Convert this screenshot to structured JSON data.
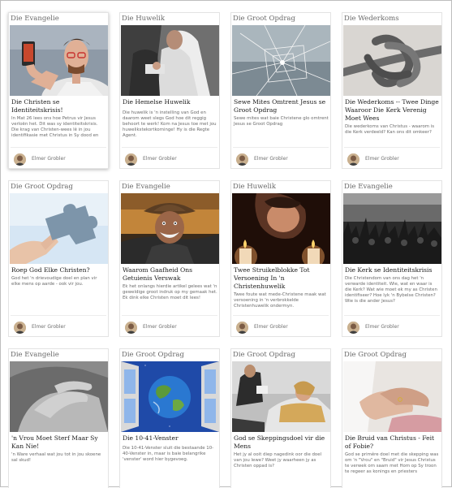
{
  "cards": [
    {
      "category": "Die Evangelie",
      "title": "Die Christen se Identiteitskrisis!",
      "excerpt": "In Mat 26 lees ons hoe Petrus vir Jesus verloën het. Dit was sy identiteitskrisis. Die krag van Christen-wees lê in jou identifikasie met Christus in Sy dood en",
      "author": "Elmer Grobler",
      "image": "man-with-phone-selfie"
    },
    {
      "category": "Die Huwelik",
      "title": "Die Hemelse Huwelik",
      "excerpt": "Die huwelik is 'n instelling van God en daarom weet slegs God hoe dit reggig behoort te werk! Kom na Jesus toe met jou huwelikstekortkominge! Hy is die Regte Agent.",
      "author": "Elmer Grobler",
      "image": "wedding-couple"
    },
    {
      "category": "Die Groot Opdrag",
      "title": "Sewe Mites Omtrent Jesus se Groot Opdrag",
      "excerpt": "Sewe mites wat baie Christene glo omtrent Jesus se Groot Opdrag",
      "author": "Elmer Grobler",
      "image": "cracked-glass"
    },
    {
      "category": "Die Wederkoms",
      "title": "Die Wederkoms -- Twee Dinge Waaroor Die Kerk Verenig Moet Wees",
      "excerpt": "Die wederkoms van Christus - waarom is die Kerk verdeeld? Kan ons dit omkeer?",
      "author": "Elmer Grobler",
      "image": "rope-knot"
    },
    {
      "category": "Die Groot Opdrag",
      "title": "Roep God Elke Christen?",
      "excerpt": "God het 'n drievoudige doel en plan vir elke mens op aarde - ook vir jou.",
      "author": "Elmer Grobler",
      "image": "puzzle-piece"
    },
    {
      "category": "Die Evangelie",
      "title": "Waarom Gaafheid Ons Getuienis Verswak",
      "excerpt": "Ek het onlangs hierdie artikel gelees wat 'n geweldige groot indruk op my gemaak het. Ek dink elke Christen moet dit lees!",
      "author": "Elmer Grobler",
      "image": "smiling-man-hat"
    },
    {
      "category": "Die Huwelik",
      "title": "Twee Struikelblokke Tot Versoening In 'n Christenhuwelik",
      "excerpt": "Twee foute wat mede-Christene maak wat versoening in 'n verbrokkelde Christenhuwelik ondermyn.",
      "author": "Elmer Grobler",
      "image": "woman-candles"
    },
    {
      "category": "Die Evangelie",
      "title": "Die Kerk se Identiteitskrisis",
      "excerpt": "Die Christendom van ons dag het 'n verwarde identiteit. Wie, wat en waar is die Kerk? Wat wie moet ek my as Christen identifiseer? Hoe lyk 'n Bybelse Christen? Wie is die ander Jesus?",
      "author": "Elmer Grobler",
      "image": "concert-crowd"
    },
    {
      "category": "Die Evangelie",
      "title": "'n Vrou Moet Sterf Maar Sy Kan Nie!",
      "excerpt": "'n Ware verhaal wat jou tot in jou skoene sal skud!",
      "author": "",
      "image": "hands-clasp"
    },
    {
      "category": "Die Groot Opdrag",
      "title": "Die 10-41-Venster",
      "excerpt": "Die 10-41-Venster sluit die bestaande 10-40-Venster in, maar is baie belangrike 'venster' word hier bygevoeg.",
      "author": "",
      "image": "earth-window"
    },
    {
      "category": "Die Groot Opdrag",
      "title": "God se Skeppingsdoel vir die Mens",
      "excerpt": "Het jy al ooit diep nagedink oor die doel van jou lewe? Weet jy waarheen jy as Christen oppad is?",
      "author": "",
      "image": "therapy-woman"
    },
    {
      "category": "Die Groot Opdrag",
      "title": "Die Bruid van Christus - Feit of Fobie?",
      "excerpt": "God se primêre doel met die skepping was om 'n \"Vrou\" en \"Bruid\" vir Jesus Christus te verwek om saam met Hom op Sy troon te regeer as konings en priesters",
      "author": "",
      "image": "bride-hands"
    }
  ]
}
